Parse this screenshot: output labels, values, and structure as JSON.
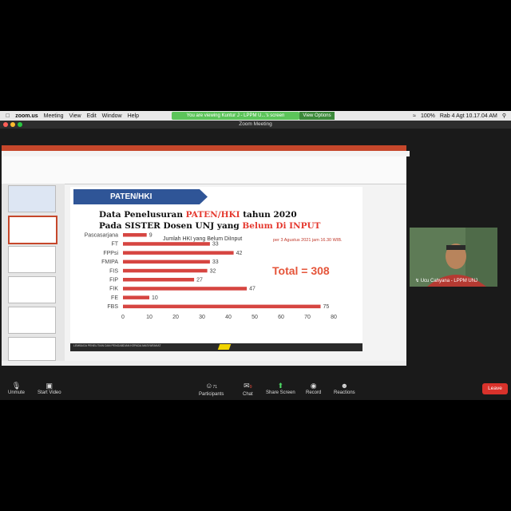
{
  "menubar": {
    "app": "zoom.us",
    "items": [
      "Meeting",
      "View",
      "Edit",
      "Window",
      "Help"
    ],
    "banner": "You are viewing Kuntur J - LPPM U...'s screen",
    "view_options": "View Options",
    "battery": "100%",
    "clock": "Rab 4 Agt  10.17.04 AM"
  },
  "window": {
    "title": "Zoom Meeting"
  },
  "slide": {
    "tag": "PATEN/HKI",
    "heading_line1_a": "Data Penelusuran ",
    "heading_line1_b": "PATEN/HKI",
    "heading_line1_c": " tahun 2020",
    "heading_line2_a": "Pada SISTER Dosen UNJ yang ",
    "heading_line2_b": "Belum Di INPUT",
    "chart_title": "Jumlah HKI yang Belum DiInput",
    "date_note": "per 3 Agustus 2021 jam 16.30 WIB.",
    "total": "Total = 308",
    "footer": "LEMBAGA PENELITIAN DAN PENGABDIAN KEPADA MASYARAKAT"
  },
  "chart_data": {
    "type": "bar",
    "orientation": "horizontal",
    "title": "Jumlah HKI yang Belum DiInput",
    "categories": [
      "Pascasarjana",
      "FT",
      "FPPsi",
      "FMIPA",
      "FIS",
      "FIP",
      "FIK",
      "FE",
      "FBS"
    ],
    "values": [
      9,
      33,
      42,
      33,
      32,
      27,
      47,
      10,
      75
    ],
    "xlim": [
      0,
      80
    ],
    "xticks": [
      0,
      10,
      20,
      30,
      40,
      50,
      60,
      70,
      80
    ],
    "bar_color": "#d64541"
  },
  "participant": {
    "name": "Ucu Cahyana - LPPM UNJ"
  },
  "toolbar": {
    "unmute": "Unmute",
    "start_video": "Start Video",
    "participants": "Participants",
    "participants_count": "71",
    "chat": "Chat",
    "chat_badge": "9",
    "share_screen": "Share Screen",
    "record": "Record",
    "reactions": "Reactions",
    "leave": "Leave"
  },
  "colors": {
    "accent_green": "#5cc45a",
    "leave_red": "#d9322b",
    "powerpoint_red": "#c6472b",
    "slide_blue": "#2f5597"
  }
}
